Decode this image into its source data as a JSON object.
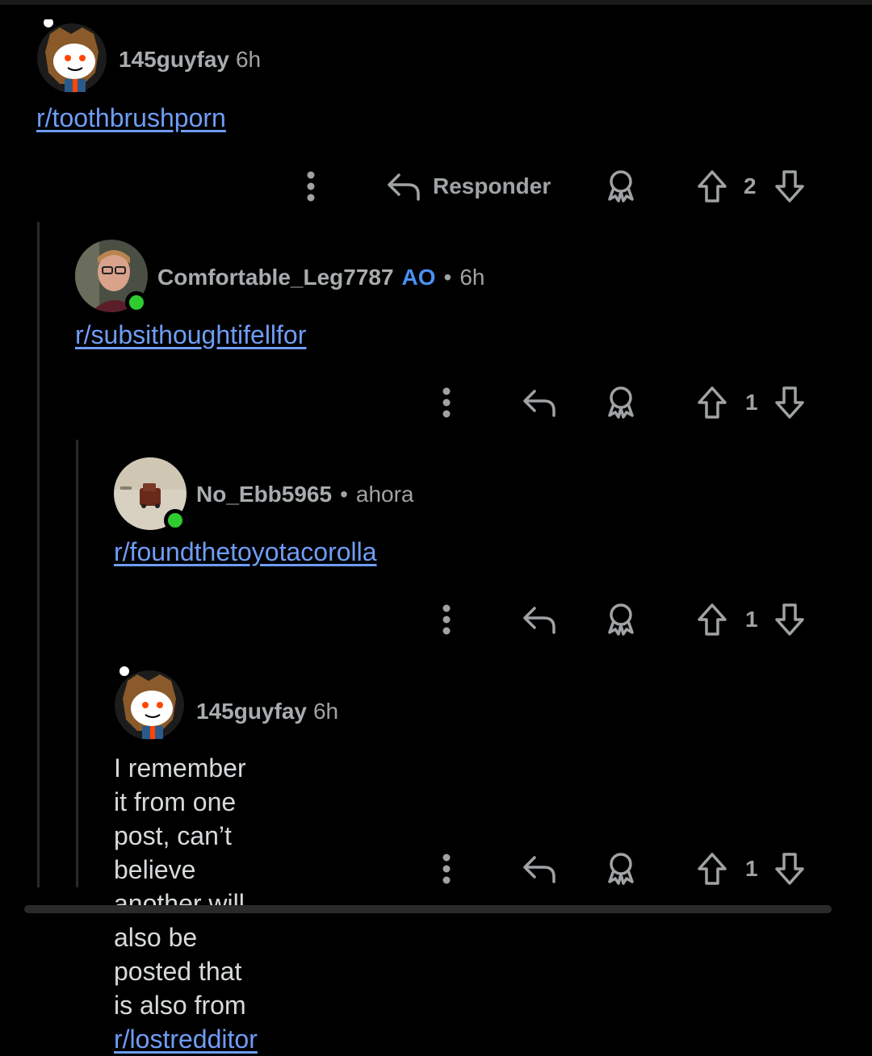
{
  "comments": [
    {
      "username": "145guyfay",
      "time": "6h",
      "op_badge": "",
      "text": "",
      "link": "r/toothbrushporn",
      "reply_label": "Responder",
      "votes": "2",
      "avatar": "owl-snoo-avatar",
      "online": false
    },
    {
      "username": "Comfortable_Leg7787",
      "op_badge": "AO",
      "separator": "•",
      "time": "6h",
      "link": "r/subsithoughtifellfor",
      "votes": "1",
      "avatar": "photo-avatar-man",
      "online": true
    },
    {
      "username": "No_Ebb5965",
      "separator": "•",
      "time": "ahora",
      "link": "r/foundthetoyotacorolla",
      "votes": "1",
      "avatar": "photo-avatar-toy-car",
      "online": true
    },
    {
      "username": "145guyfay",
      "time": "6h",
      "text_line1": "I remember it from one post, can’t believe another will",
      "text_line2_prefix": "also be posted that is also from ",
      "link": "r/lostredditor",
      "votes": "1",
      "avatar": "owl-snoo-avatar",
      "online": false
    }
  ],
  "colors": {
    "background": "#000000",
    "link": "#6f9df6",
    "op_badge": "#4a90f2",
    "online": "#2ecc2e",
    "muted": "#a0a3a5"
  },
  "icons": [
    "more-options-icon",
    "reply-icon",
    "award-icon",
    "upvote-icon",
    "downvote-icon"
  ]
}
